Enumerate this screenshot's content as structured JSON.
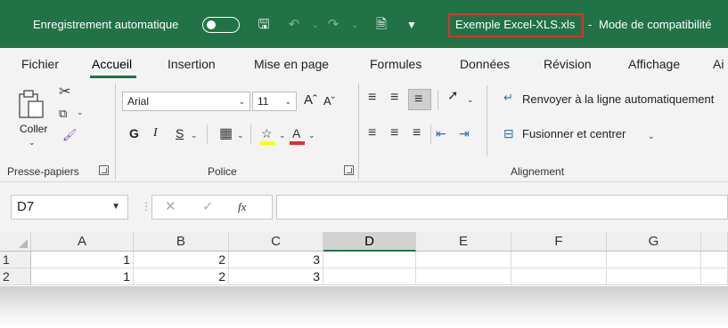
{
  "titlebar": {
    "autosave_label": "Enregistrement automatique",
    "filename": "Exemple Excel-XLS.xls",
    "separator": "-",
    "mode": "Mode de compatibilité",
    "accent_color": "#217346",
    "highlight_color": "#e0302f"
  },
  "tabs": [
    {
      "label": "Fichier"
    },
    {
      "label": "Accueil"
    },
    {
      "label": "Insertion"
    },
    {
      "label": "Mise en page"
    },
    {
      "label": "Formules"
    },
    {
      "label": "Données"
    },
    {
      "label": "Révision"
    },
    {
      "label": "Affichage"
    },
    {
      "label": "Ai"
    }
  ],
  "ribbon": {
    "clipboard": {
      "paste_label": "Coller",
      "group_label": "Presse-papiers"
    },
    "font": {
      "font_name": "Arial",
      "font_size": "11",
      "bold": "G",
      "italic": "I",
      "underline": "S",
      "group_label": "Police"
    },
    "alignment": {
      "wrap_label": "Renvoyer à la ligne automatiquement",
      "merge_label": "Fusionner et centrer",
      "group_label": "Alignement"
    }
  },
  "formula_bar": {
    "name_box": "D7",
    "fx": "fx",
    "value": ""
  },
  "grid": {
    "columns": [
      "A",
      "B",
      "C",
      "D",
      "E",
      "F",
      "G"
    ],
    "selected_column": "D",
    "rows": [
      {
        "label": "1",
        "cells": [
          "1",
          "2",
          "3",
          "",
          "",
          "",
          ""
        ]
      },
      {
        "label": "2",
        "cells": [
          "1",
          "2",
          "3",
          "",
          "",
          "",
          ""
        ]
      }
    ]
  }
}
